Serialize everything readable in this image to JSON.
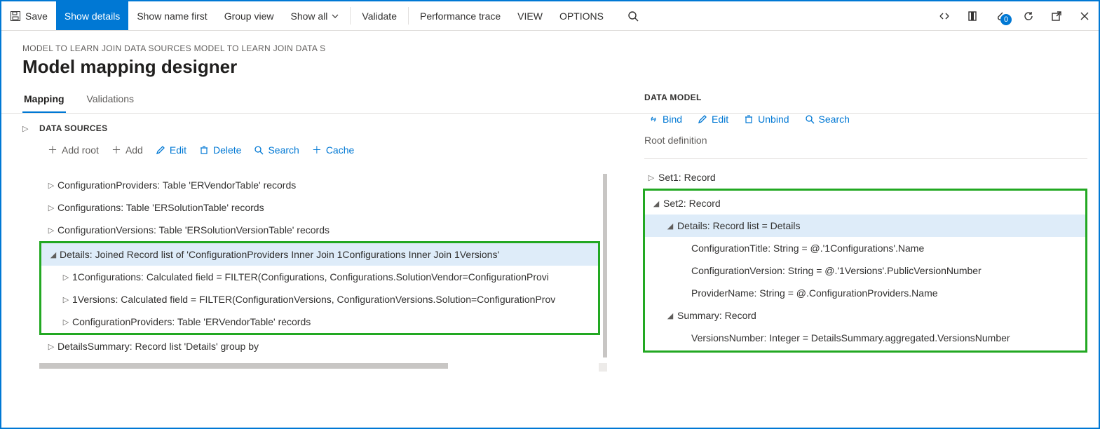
{
  "cmdbar": {
    "save": "Save",
    "show_details": "Show details",
    "show_name_first": "Show name first",
    "group_view": "Group view",
    "show_all": "Show all",
    "validate": "Validate",
    "perf_trace": "Performance trace",
    "view": "VIEW",
    "options": "OPTIONS",
    "attach_badge": "0"
  },
  "breadcrumb": "MODEL TO LEARN JOIN DATA SOURCES MODEL TO LEARN JOIN DATA S",
  "page_title": "Model mapping designer",
  "tabs": {
    "mapping": "Mapping",
    "validations": "Validations"
  },
  "data_sources": {
    "header": "DATA SOURCES",
    "add_root": "Add root",
    "add": "Add",
    "edit": "Edit",
    "delete": "Delete",
    "search": "Search",
    "cache": "Cache",
    "rows": {
      "r0": "ConfigurationProviders: Table 'ERVendorTable' records",
      "r1": "Configurations: Table 'ERSolutionTable' records",
      "r2": "ConfigurationVersions: Table 'ERSolutionVersionTable' records",
      "r3": "Details: Joined Record list of 'ConfigurationProviders Inner Join 1Configurations Inner Join 1Versions'",
      "r4": "1Configurations: Calculated field = FILTER(Configurations, Configurations.SolutionVendor=ConfigurationProvi",
      "r5": "1Versions: Calculated field = FILTER(ConfigurationVersions, ConfigurationVersions.Solution=ConfigurationProv",
      "r6": "ConfigurationProviders: Table 'ERVendorTable' records",
      "r7": "DetailsSummary: Record list 'Details' group by"
    }
  },
  "data_model": {
    "header": "DATA MODEL",
    "bind": "Bind",
    "edit": "Edit",
    "unbind": "Unbind",
    "search": "Search",
    "root_def": "Root definition",
    "rows": {
      "d0": "Set1: Record",
      "d1": "Set2: Record",
      "d2": "Details: Record list = Details",
      "d3": "ConfigurationTitle: String = @.'1Configurations'.Name",
      "d4": "ConfigurationVersion: String = @.'1Versions'.PublicVersionNumber",
      "d5": "ProviderName: String = @.ConfigurationProviders.Name",
      "d6": "Summary: Record",
      "d7": "VersionsNumber: Integer = DetailsSummary.aggregated.VersionsNumber"
    }
  }
}
